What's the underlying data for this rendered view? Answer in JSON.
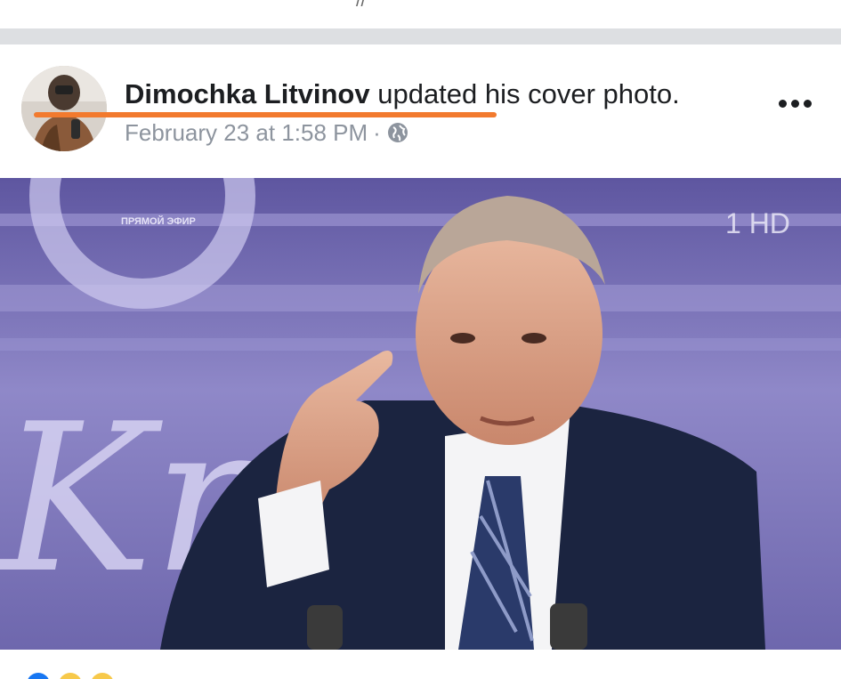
{
  "post": {
    "author": "Dimochka Litvinov",
    "action": " updated his cover photo.",
    "timestamp": "February 23 at 1:58 PM",
    "separator": "·",
    "privacy_icon": "globe-icon",
    "more_icon": "more-options-icon"
  },
  "photo": {
    "overlay_caption": "ПРЯМОЙ ЭФИР",
    "channel_logo": "1 HD",
    "backdrop_letters": "Kr"
  },
  "reactions": {
    "icons": [
      "like-icon",
      "haha-icon",
      "wow-icon"
    ]
  },
  "colors": {
    "author_text": "#1c1e21",
    "meta_text": "#8d949e",
    "highlight_underline": "#f27a2e",
    "separator": "#dddfe2"
  }
}
